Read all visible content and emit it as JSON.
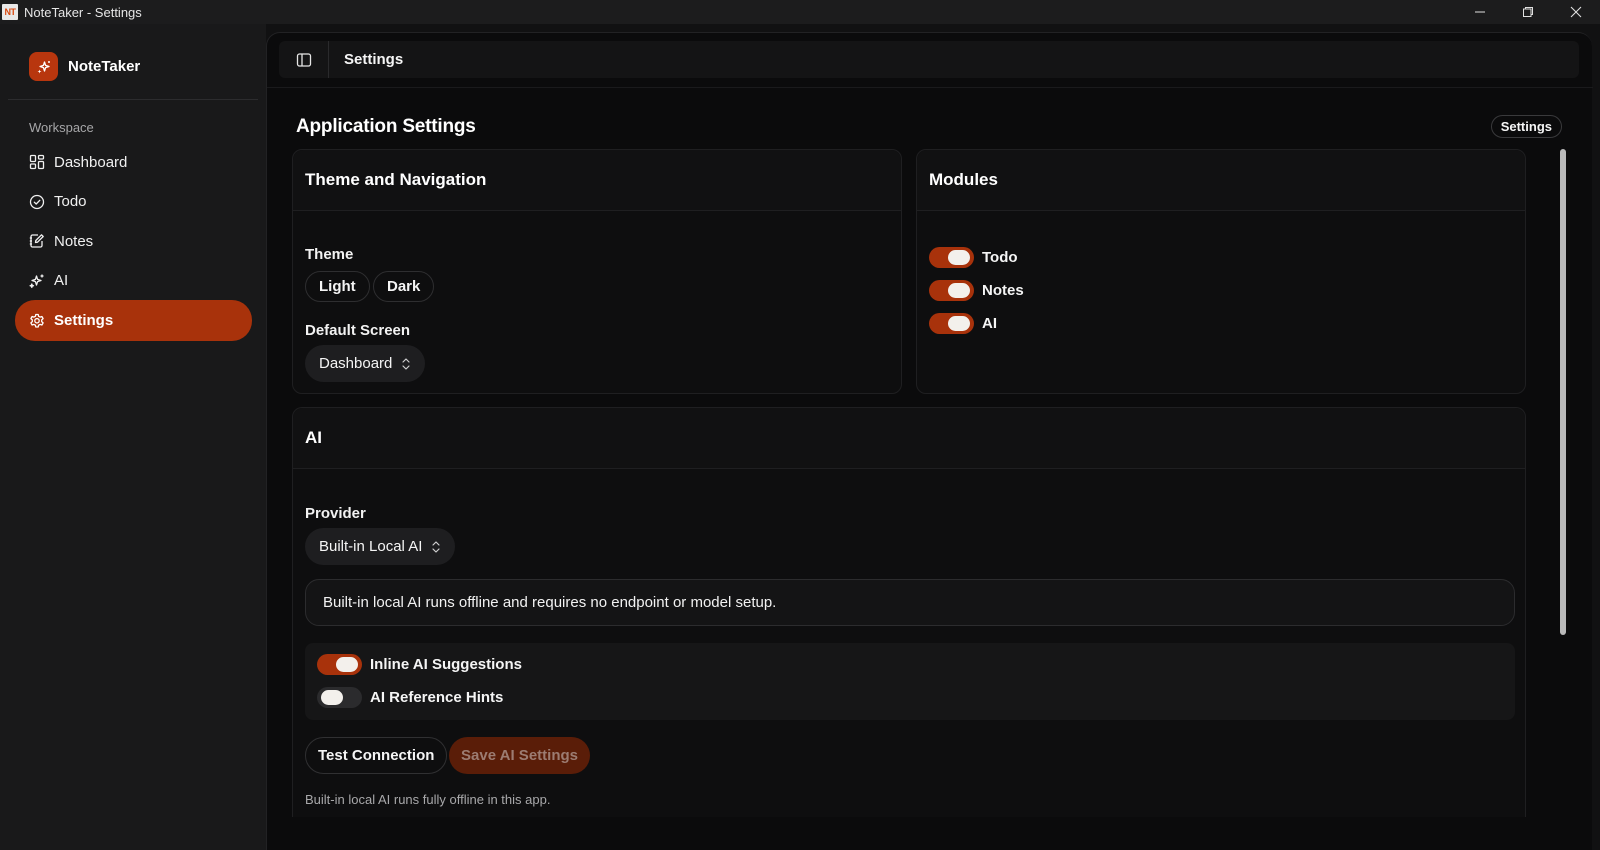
{
  "window": {
    "title": "NoteTaker - Settings",
    "icon_text": "NT"
  },
  "sidebar": {
    "brand_name": "NoteTaker",
    "section_label": "Workspace",
    "items": [
      {
        "label": "Dashboard",
        "icon": "dashboard-icon"
      },
      {
        "label": "Todo",
        "icon": "check-circle-icon"
      },
      {
        "label": "Notes",
        "icon": "notes-icon"
      },
      {
        "label": "AI",
        "icon": "sparkles-icon"
      },
      {
        "label": "Settings",
        "icon": "gear-icon",
        "active": true
      }
    ]
  },
  "topbar": {
    "title": "Settings"
  },
  "page": {
    "title": "Application Settings",
    "badge": "Settings"
  },
  "theme_card": {
    "title": "Theme and Navigation",
    "theme_label": "Theme",
    "theme_options": [
      "Light",
      "Dark"
    ],
    "default_screen_label": "Default Screen",
    "default_screen_value": "Dashboard"
  },
  "modules_card": {
    "title": "Modules",
    "modules": [
      {
        "label": "Todo",
        "enabled": true
      },
      {
        "label": "Notes",
        "enabled": true
      },
      {
        "label": "AI",
        "enabled": true
      }
    ]
  },
  "ai_card": {
    "title": "AI",
    "provider_label": "Provider",
    "provider_value": "Built-in Local AI",
    "info_text": "Built-in local AI runs offline and requires no endpoint or model setup.",
    "toggles": [
      {
        "label": "Inline AI Suggestions",
        "enabled": true
      },
      {
        "label": "AI Reference Hints",
        "enabled": false
      }
    ],
    "test_button": "Test Connection",
    "save_button": "Save AI Settings",
    "footnote": "Built-in local AI runs fully offline in this app."
  },
  "colors": {
    "accent": "#a8320b",
    "accent_disabled": "#5a1d08",
    "background": "#0b0b0c",
    "sidebar": "#19191a"
  }
}
